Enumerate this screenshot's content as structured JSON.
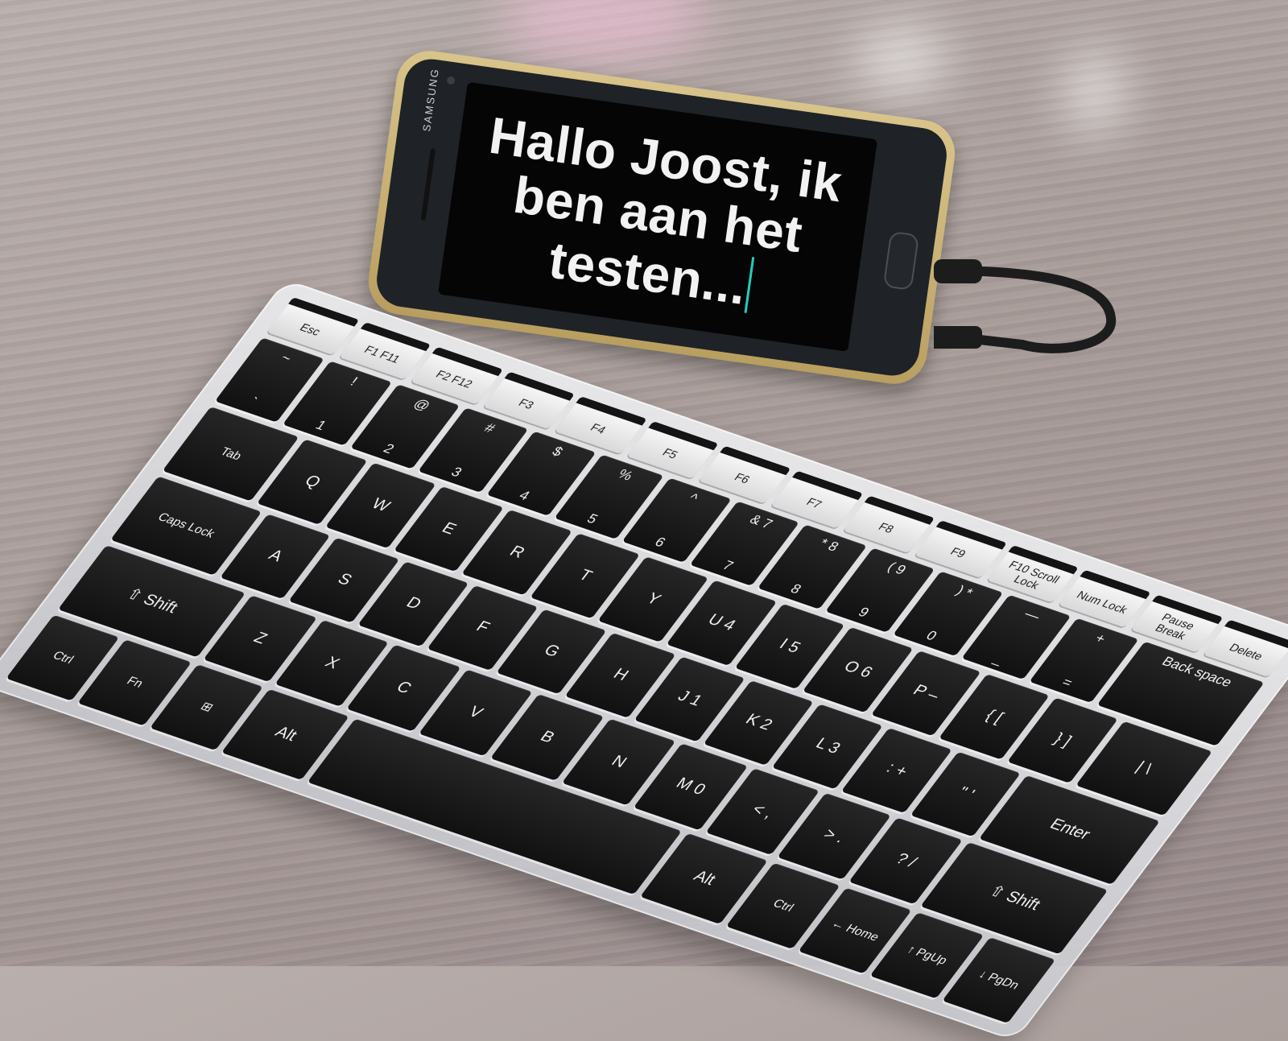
{
  "phone": {
    "brand": "SAMSUNG",
    "screen_text": "Hallo Joost, ik ben aan het testen..."
  },
  "keyboard": {
    "fn_row": [
      "Esc",
      "F1 F11",
      "F2 F12",
      "F3",
      "F4",
      "F5",
      "F6",
      "F7",
      "F8",
      "F9",
      "F10 Scroll Lock",
      "Num Lock",
      "Pause Break",
      "Delete"
    ],
    "number_row": [
      {
        "upper": "~",
        "lower": "`"
      },
      {
        "upper": "!",
        "lower": "1"
      },
      {
        "upper": "@",
        "lower": "2"
      },
      {
        "upper": "#",
        "lower": "3"
      },
      {
        "upper": "$",
        "lower": "4"
      },
      {
        "upper": "%",
        "lower": "5"
      },
      {
        "upper": "^",
        "lower": "6"
      },
      {
        "upper": "& 7",
        "lower": "7"
      },
      {
        "upper": "* 8",
        "lower": "8"
      },
      {
        "upper": "( 9",
        "lower": "9"
      },
      {
        "upper": ") *",
        "lower": "0"
      },
      {
        "upper": "—",
        "lower": "_"
      },
      {
        "upper": "+",
        "lower": "="
      },
      {
        "upper": "Back space",
        "lower": ""
      }
    ],
    "tab_row": [
      "Tab",
      "Q",
      "W",
      "E",
      "R",
      "T",
      "Y",
      "U 4",
      "I 5",
      "O 6",
      "P –",
      "{ [",
      "} ]",
      "| \\"
    ],
    "caps_row": [
      "Caps Lock",
      "A",
      "S",
      "D",
      "F",
      "G",
      "H",
      "J 1",
      "K 2",
      "L 3",
      ": +",
      "\" '",
      "Enter"
    ],
    "shift_row": [
      "⇧ Shift",
      "Z",
      "X",
      "C",
      "V",
      "B",
      "N",
      "M 0",
      "< ,",
      "> .",
      "? /",
      "⇧ Shift"
    ],
    "bottom_row": [
      "Ctrl",
      "Fn",
      "⊞",
      "Alt",
      "",
      "Alt",
      "Ctrl",
      "← Home",
      "↑ PgUp",
      "↓ PgDn"
    ]
  }
}
